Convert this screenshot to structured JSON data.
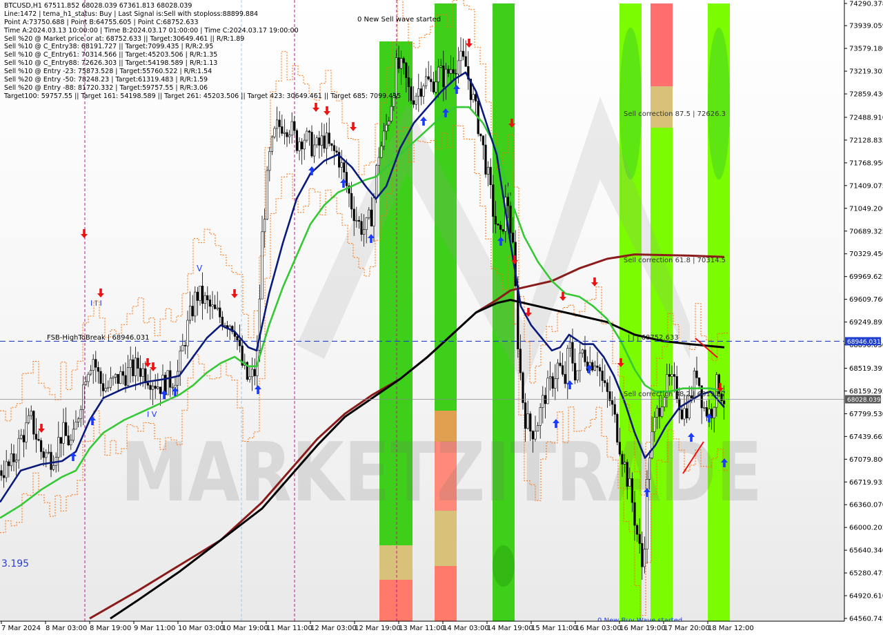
{
  "header": {
    "lines": [
      "BTCUSD,H1  67511.852 68028.039 67361.813 68028.039",
      "Line:1472 | tema_h1_status: Buy | Last Signal is:Sell with stoploss:88899.884",
      "Point A:73750.688 | Point B:64755.605 | Point C:68752.633",
      "Time A:2024.03.13 10:00:00 | Time B:2024.03.17 01:00:00 | Time C:2024.03.17 19:00:00",
      "Sell %20 @ Market price or at: 68752.633 || Target:30649.461 || R/R:1.89",
      "Sell %10 @ C_Entry38: 68191.727 || Target:7099.435 | R/R:2.95",
      "Sell %10 @ C_Entry61: 70314.566 || Target:45203.506 | R/R:1.35",
      "Sell %10 @ C_Entry88: 72626.303 || Target:54198.589 | R/R:1.13",
      "Sell %10 @ Entry -23: 75873.528 | Target:55760.522 | R/R:1.54",
      "Sell %20 @ Entry -50: 78248.23 | Target:61319.483 | R/R:1.59",
      "Sell %20 @ Entry -88: 81720.332 | Target:59757.55 | R/R:3.06",
      "Target100: 59757.55 || Target 161: 54198.589 || Target 261: 45203.506 || Target 423: 30649.461 || Target 685: 7099.435"
    ]
  },
  "annotations": {
    "new_sell_wave": "0 New Sell wave started",
    "new_buy_wave": "0 New Buy Wave started",
    "fsb_label": "FSB-HighToBreak | 68946.031",
    "sell_corr_875": "Sell correction 87.5 | 72626.3",
    "sell_corr_618": "Sell correction 61.8 | 70314.5",
    "sell_corr_382": "Sell correction 38.2 | 68191.7",
    "point_c_label": "| | | 68752.633",
    "left_value": "3.195",
    "wave_v_top": "V",
    "wave_iii": "I I I",
    "wave_iv": "I V",
    "watermark": "MARKETZITRADE"
  },
  "price_badges": {
    "fsb": "68946.031",
    "current": "68028.039",
    "fsb_color": "#1f3fcf",
    "current_color": "#5a5a5a"
  },
  "colors": {
    "green_zone": "#3ecf1a",
    "bright_green": "#7cfc00",
    "red_zone": "#ff6f6f",
    "tema_blue": "#0a1a7a",
    "green_ma": "#35c835",
    "dark_red_ma": "#8b1a1a",
    "black_ma": "#000000",
    "envelope": "#ff6a00",
    "sell_arrow": "#ee1111",
    "buy_arrow": "#1a3cff"
  },
  "chart_data": {
    "type": "candlestick",
    "symbol": "BTCUSD",
    "timeframe": "H1",
    "ohlc_last": {
      "open": 67511.852,
      "high": 68028.039,
      "low": 67361.813,
      "close": 68028.039
    },
    "ylim": [
      64560.745,
      74290.378
    ],
    "y_ticks": [
      74290.378,
      73939.059,
      73579.18,
      73219.305,
      72859.43,
      72488.91,
      72128.835,
      71768.95,
      71409.075,
      71049.2,
      70689.325,
      70329.45,
      69969.625,
      69609.76,
      69249.895,
      68890.05,
      68519.395,
      68159.295,
      67799.53,
      67439.665,
      67079.8,
      66719.935,
      66360.07,
      66000.205,
      65640.34,
      65280.475,
      64920.61,
      64560.745
    ],
    "x_ticks": [
      "7 Mar 2024",
      "8 Mar 03:00",
      "8 Mar 19:00",
      "9 Mar 11:00",
      "10 Mar 03:00",
      "10 Mar 19:00",
      "11 Mar 11:00",
      "12 Mar 03:00",
      "12 Mar 19:00",
      "13 Mar 11:00",
      "14 Mar 03:00",
      "14 Mar 19:00",
      "15 Mar 11:00",
      "16 Mar 03:00",
      "16 Mar 19:00",
      "17 Mar 20:00",
      "18 Mar 12:00"
    ],
    "levels": {
      "fsb_high_to_break": 68946.031,
      "current_price": 68028.039,
      "sell_correction_87_5": 72626.3,
      "sell_correction_61_8": 70314.5,
      "sell_correction_38_2": 68191.7,
      "point_a": 73750.688,
      "point_b": 64755.605,
      "point_c": 68752.633
    },
    "close_path": [
      [
        0,
        66900
      ],
      [
        15,
        66950
      ],
      [
        30,
        67400
      ],
      [
        45,
        67700
      ],
      [
        60,
        67200
      ],
      [
        75,
        67100
      ],
      [
        90,
        67500
      ],
      [
        105,
        67300
      ],
      [
        115,
        67900
      ],
      [
        125,
        68500
      ],
      [
        135,
        68700
      ],
      [
        145,
        68300
      ],
      [
        155,
        68200
      ],
      [
        170,
        68350
      ],
      [
        185,
        68450
      ],
      [
        200,
        68550
      ],
      [
        215,
        68400
      ],
      [
        230,
        68250
      ],
      [
        245,
        68300
      ],
      [
        258,
        68450
      ],
      [
        270,
        69100
      ],
      [
        285,
        69700
      ],
      [
        295,
        69600
      ],
      [
        310,
        69400
      ],
      [
        325,
        69300
      ],
      [
        340,
        69200
      ],
      [
        350,
        68600
      ],
      [
        360,
        68300
      ],
      [
        372,
        68500
      ],
      [
        380,
        70600
      ],
      [
        390,
        71800
      ],
      [
        400,
        72300
      ],
      [
        410,
        72400
      ],
      [
        420,
        72350
      ],
      [
        430,
        72100
      ],
      [
        440,
        72200
      ],
      [
        450,
        72050
      ],
      [
        460,
        72000
      ],
      [
        470,
        72150
      ],
      [
        480,
        71950
      ],
      [
        490,
        71900
      ],
      [
        500,
        71500
      ],
      [
        510,
        71100
      ],
      [
        520,
        70800
      ],
      [
        530,
        70700
      ],
      [
        540,
        71000
      ],
      [
        548,
        71900
      ],
      [
        555,
        72100
      ],
      [
        565,
        72600
      ],
      [
        575,
        73300
      ],
      [
        585,
        73200
      ],
      [
        595,
        72800
      ],
      [
        605,
        72900
      ],
      [
        615,
        73100
      ],
      [
        625,
        73000
      ],
      [
        635,
        73200
      ],
      [
        645,
        73100
      ],
      [
        655,
        73300
      ],
      [
        665,
        73400
      ],
      [
        675,
        73300
      ],
      [
        685,
        72800
      ],
      [
        695,
        72300
      ],
      [
        705,
        71700
      ],
      [
        715,
        71000
      ],
      [
        725,
        70500
      ],
      [
        735,
        71300
      ],
      [
        745,
        70200
      ],
      [
        752,
        68700
      ],
      [
        760,
        67800
      ],
      [
        770,
        67500
      ],
      [
        780,
        67700
      ],
      [
        790,
        68100
      ],
      [
        800,
        68300
      ],
      [
        810,
        68600
      ],
      [
        818,
        68200
      ],
      [
        825,
        68900
      ],
      [
        835,
        68400
      ],
      [
        845,
        68800
      ],
      [
        855,
        68600
      ],
      [
        865,
        68700
      ],
      [
        875,
        68200
      ],
      [
        885,
        68000
      ],
      [
        895,
        67500
      ],
      [
        905,
        67000
      ],
      [
        915,
        66500
      ],
      [
        925,
        65800
      ],
      [
        932,
        65300
      ],
      [
        940,
        67100
      ],
      [
        950,
        67700
      ],
      [
        960,
        68100
      ],
      [
        970,
        68300
      ],
      [
        980,
        68200
      ],
      [
        990,
        67800
      ],
      [
        1000,
        68000
      ],
      [
        1010,
        68500
      ],
      [
        1020,
        67900
      ],
      [
        1030,
        67800
      ],
      [
        1040,
        68300
      ],
      [
        1050,
        68028
      ]
    ],
    "series": [
      {
        "name": "tema_blue",
        "points": [
          [
            0,
            66400
          ],
          [
            30,
            66900
          ],
          [
            60,
            67000
          ],
          [
            90,
            67050
          ],
          [
            110,
            67200
          ],
          [
            130,
            67700
          ],
          [
            150,
            68050
          ],
          [
            180,
            68200
          ],
          [
            210,
            68300
          ],
          [
            240,
            68350
          ],
          [
            260,
            68400
          ],
          [
            280,
            68700
          ],
          [
            300,
            69000
          ],
          [
            320,
            69200
          ],
          [
            340,
            69100
          ],
          [
            360,
            68850
          ],
          [
            372,
            68800
          ],
          [
            390,
            69700
          ],
          [
            410,
            70500
          ],
          [
            430,
            71200
          ],
          [
            450,
            71600
          ],
          [
            470,
            71800
          ],
          [
            490,
            71900
          ],
          [
            510,
            71700
          ],
          [
            530,
            71400
          ],
          [
            545,
            71200
          ],
          [
            560,
            71400
          ],
          [
            580,
            72000
          ],
          [
            600,
            72400
          ],
          [
            620,
            72650
          ],
          [
            640,
            72900
          ],
          [
            660,
            73100
          ],
          [
            675,
            73200
          ],
          [
            690,
            72900
          ],
          [
            705,
            72400
          ],
          [
            720,
            71900
          ],
          [
            740,
            70500
          ],
          [
            755,
            69500
          ],
          [
            770,
            69200
          ],
          [
            785,
            69000
          ],
          [
            800,
            68800
          ],
          [
            812,
            68850
          ],
          [
            825,
            69050
          ],
          [
            845,
            68900
          ],
          [
            860,
            68900
          ],
          [
            875,
            68700
          ],
          [
            890,
            68400
          ],
          [
            905,
            68000
          ],
          [
            920,
            67500
          ],
          [
            935,
            67100
          ],
          [
            950,
            67300
          ],
          [
            965,
            67600
          ],
          [
            985,
            67900
          ],
          [
            1000,
            68000
          ],
          [
            1015,
            68100
          ],
          [
            1030,
            68150
          ],
          [
            1050,
            67900
          ]
        ]
      },
      {
        "name": "green_ma",
        "points": [
          [
            0,
            66150
          ],
          [
            30,
            66350
          ],
          [
            60,
            66600
          ],
          [
            90,
            66800
          ],
          [
            110,
            66900
          ],
          [
            130,
            67250
          ],
          [
            150,
            67500
          ],
          [
            180,
            67700
          ],
          [
            210,
            67850
          ],
          [
            240,
            68000
          ],
          [
            260,
            68100
          ],
          [
            280,
            68250
          ],
          [
            300,
            68450
          ],
          [
            320,
            68600
          ],
          [
            340,
            68700
          ],
          [
            360,
            68550
          ],
          [
            372,
            68550
          ],
          [
            390,
            69200
          ],
          [
            410,
            69800
          ],
          [
            430,
            70300
          ],
          [
            450,
            70800
          ],
          [
            470,
            71100
          ],
          [
            490,
            71300
          ],
          [
            510,
            71400
          ],
          [
            530,
            71500
          ],
          [
            545,
            71550
          ],
          [
            560,
            71700
          ],
          [
            580,
            71900
          ],
          [
            600,
            72100
          ],
          [
            620,
            72300
          ],
          [
            640,
            72500
          ],
          [
            660,
            72650
          ],
          [
            680,
            72650
          ],
          [
            700,
            72400
          ],
          [
            720,
            72000
          ],
          [
            740,
            71200
          ],
          [
            760,
            70600
          ],
          [
            780,
            70200
          ],
          [
            800,
            69900
          ],
          [
            820,
            69700
          ],
          [
            840,
            69650
          ],
          [
            860,
            69500
          ],
          [
            880,
            69300
          ],
          [
            900,
            68950
          ],
          [
            920,
            68500
          ],
          [
            935,
            68250
          ],
          [
            950,
            68150
          ],
          [
            970,
            68150
          ],
          [
            990,
            68200
          ],
          [
            1010,
            68200
          ],
          [
            1030,
            68200
          ],
          [
            1050,
            68150
          ]
        ]
      },
      {
        "name": "dark_red_ma",
        "points": [
          [
            130,
            64560
          ],
          [
            200,
            65000
          ],
          [
            260,
            65400
          ],
          [
            320,
            65800
          ],
          [
            380,
            66400
          ],
          [
            420,
            66900
          ],
          [
            460,
            67400
          ],
          [
            500,
            67800
          ],
          [
            540,
            68100
          ],
          [
            580,
            68350
          ],
          [
            620,
            68700
          ],
          [
            660,
            69100
          ],
          [
            690,
            69400
          ],
          [
            720,
            69600
          ],
          [
            740,
            69750
          ],
          [
            760,
            69800
          ],
          [
            800,
            69900
          ],
          [
            840,
            70100
          ],
          [
            880,
            70250
          ],
          [
            920,
            70320
          ],
          [
            960,
            70310
          ],
          [
            1000,
            70300
          ],
          [
            1050,
            70280
          ]
        ]
      },
      {
        "name": "black_ma",
        "points": [
          [
            160,
            64560
          ],
          [
            200,
            64850
          ],
          [
            260,
            65300
          ],
          [
            320,
            65800
          ],
          [
            380,
            66300
          ],
          [
            420,
            66800
          ],
          [
            460,
            67300
          ],
          [
            500,
            67750
          ],
          [
            540,
            68050
          ],
          [
            580,
            68350
          ],
          [
            620,
            68700
          ],
          [
            660,
            69100
          ],
          [
            690,
            69400
          ],
          [
            720,
            69550
          ],
          [
            740,
            69600
          ],
          [
            760,
            69550
          ],
          [
            800,
            69450
          ],
          [
            840,
            69350
          ],
          [
            880,
            69250
          ],
          [
            920,
            69050
          ],
          [
            960,
            68950
          ],
          [
            1000,
            68900
          ],
          [
            1050,
            68850
          ]
        ]
      }
    ],
    "zones": [
      {
        "x1": 550,
        "x2": 598,
        "kind": "green"
      },
      {
        "x1": 630,
        "x2": 662,
        "kind": "green"
      },
      {
        "x1": 714,
        "x2": 746,
        "kind": "green"
      },
      {
        "x1": 898,
        "x2": 930,
        "kind": "bright"
      },
      {
        "x1": 943,
        "x2": 975,
        "kind": "red"
      },
      {
        "x1": 1026,
        "x2": 1058,
        "kind": "bright"
      }
    ],
    "sell_signals": [
      [
        60,
        622
      ],
      [
        122,
        340
      ],
      [
        146,
        426
      ],
      [
        214,
        527
      ],
      [
        222,
        533
      ],
      [
        340,
        427
      ],
      [
        458,
        157
      ],
      [
        474,
        162
      ],
      [
        512,
        185
      ],
      [
        680,
        64
      ],
      [
        742,
        180
      ],
      [
        746,
        378
      ],
      [
        766,
        454
      ],
      [
        816,
        431
      ],
      [
        862,
        410
      ],
      [
        900,
        527
      ],
      [
        1044,
        563
      ]
    ],
    "buy_signals": [
      [
        134,
        608
      ],
      [
        106,
        660
      ],
      [
        238,
        570
      ],
      [
        254,
        566
      ],
      [
        374,
        563
      ],
      [
        452,
        246
      ],
      [
        498,
        264
      ],
      [
        538,
        344
      ],
      [
        614,
        174
      ],
      [
        646,
        162
      ],
      [
        662,
        128
      ],
      [
        726,
        348
      ],
      [
        806,
        612
      ],
      [
        826,
        556
      ],
      [
        854,
        533
      ],
      [
        938,
        712
      ],
      [
        1002,
        632
      ],
      [
        1028,
        604
      ],
      [
        1050,
        669
      ]
    ]
  }
}
